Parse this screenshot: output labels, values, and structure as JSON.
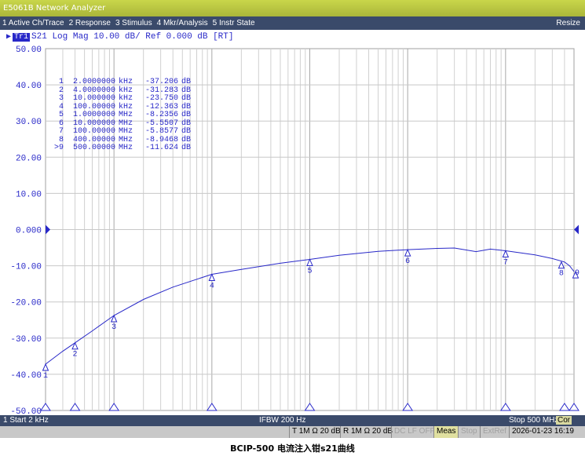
{
  "window": {
    "title": "E5061B Network Analyzer"
  },
  "menu": {
    "items": [
      "1 Active Ch/Trace",
      "2 Response",
      "3 Stimulus",
      "4 Mkr/Analysis",
      "5 Instr State"
    ],
    "resize": "Resize"
  },
  "trace": {
    "badge": "Tr1",
    "text": "S21 Log Mag 10.00 dB/ Ref 0.000 dB [RT]",
    "color": "#2828c8"
  },
  "markers": [
    {
      "num": "1",
      "freq": "2.0000000",
      "unit": "kHz",
      "value": "-37.206",
      "db": "dB"
    },
    {
      "num": "2",
      "freq": "4.0000000",
      "unit": "kHz",
      "value": "-31.283",
      "db": "dB"
    },
    {
      "num": "3",
      "freq": "10.000000",
      "unit": "kHz",
      "value": "-23.750",
      "db": "dB"
    },
    {
      "num": "4",
      "freq": "100.00000",
      "unit": "kHz",
      "value": "-12.363",
      "db": "dB"
    },
    {
      "num": "5",
      "freq": "1.0000000",
      "unit": "MHz",
      "value": "-8.2356",
      "db": "dB"
    },
    {
      "num": "6",
      "freq": "10.000000",
      "unit": "MHz",
      "value": "-5.5507",
      "db": "dB"
    },
    {
      "num": "7",
      "freq": "100.00000",
      "unit": "MHz",
      "value": "-5.8577",
      "db": "dB"
    },
    {
      "num": "8",
      "freq": "400.00000",
      "unit": "MHz",
      "value": "-8.9468",
      "db": "dB"
    },
    {
      "num": ">9",
      "freq": "500.00000",
      "unit": "MHz",
      "value": "-11.624",
      "db": "dB"
    }
  ],
  "chart_data": {
    "type": "line",
    "x_scale": "log",
    "xlim": [
      2000,
      500000000
    ],
    "ylim": [
      -50,
      50
    ],
    "yticks": [
      "50.00",
      "40.00",
      "30.00",
      "20.00",
      "10.00",
      "0.000",
      "-10.00",
      "-20.00",
      "-30.00",
      "-40.00",
      "-50.00"
    ],
    "ref_level": 0,
    "grid": true,
    "series": [
      {
        "name": "S21",
        "color": "#2828c8",
        "points": [
          [
            2000,
            -37.2
          ],
          [
            3000,
            -33.6
          ],
          [
            4000,
            -31.3
          ],
          [
            6000,
            -28.0
          ],
          [
            10000,
            -23.75
          ],
          [
            20000,
            -19.3
          ],
          [
            40000,
            -15.9
          ],
          [
            100000,
            -12.36
          ],
          [
            200000,
            -11.0
          ],
          [
            500000,
            -9.3
          ],
          [
            1000000,
            -8.24
          ],
          [
            2000000,
            -7.1
          ],
          [
            5000000,
            -6.0
          ],
          [
            10000000,
            -5.55
          ],
          [
            20000000,
            -5.2
          ],
          [
            30000000,
            -5.1
          ],
          [
            50000000,
            -6.1
          ],
          [
            70000000,
            -5.4
          ],
          [
            100000000,
            -5.86
          ],
          [
            200000000,
            -7.0
          ],
          [
            300000000,
            -8.0
          ],
          [
            400000000,
            -8.95
          ],
          [
            450000000,
            -10.0
          ],
          [
            500000000,
            -11.6
          ]
        ]
      }
    ],
    "markers": [
      {
        "label": "1",
        "x": 2000,
        "y": -37.206
      },
      {
        "label": "2",
        "x": 4000,
        "y": -31.283
      },
      {
        "label": "3",
        "x": 10000,
        "y": -23.75
      },
      {
        "label": "4",
        "x": 100000,
        "y": -12.363
      },
      {
        "label": "5",
        "x": 1000000,
        "y": -8.2356
      },
      {
        "label": "6",
        "x": 10000000,
        "y": -5.5507
      },
      {
        "label": "7",
        "x": 100000000,
        "y": -5.8577
      },
      {
        "label": "8",
        "x": 400000000,
        "y": -8.9468
      },
      {
        "label": "9",
        "x": 500000000,
        "y": -11.624
      }
    ]
  },
  "status": {
    "start": "1  Start 2 kHz",
    "ifbw": "IFBW 200 Hz",
    "stop": "Stop 500 MHz",
    "cor": "Cor"
  },
  "info": {
    "t": "T 1M Ω 20 dB",
    "r": "R 1M Ω 20 dB",
    "dclf": "DC LF OFF",
    "meas": "Meas",
    "stop": "Stop",
    "extref": "ExtRef",
    "datetime": "2026-01-23 16:19"
  },
  "caption": "BCIP-500 电流注入钳s21曲线"
}
